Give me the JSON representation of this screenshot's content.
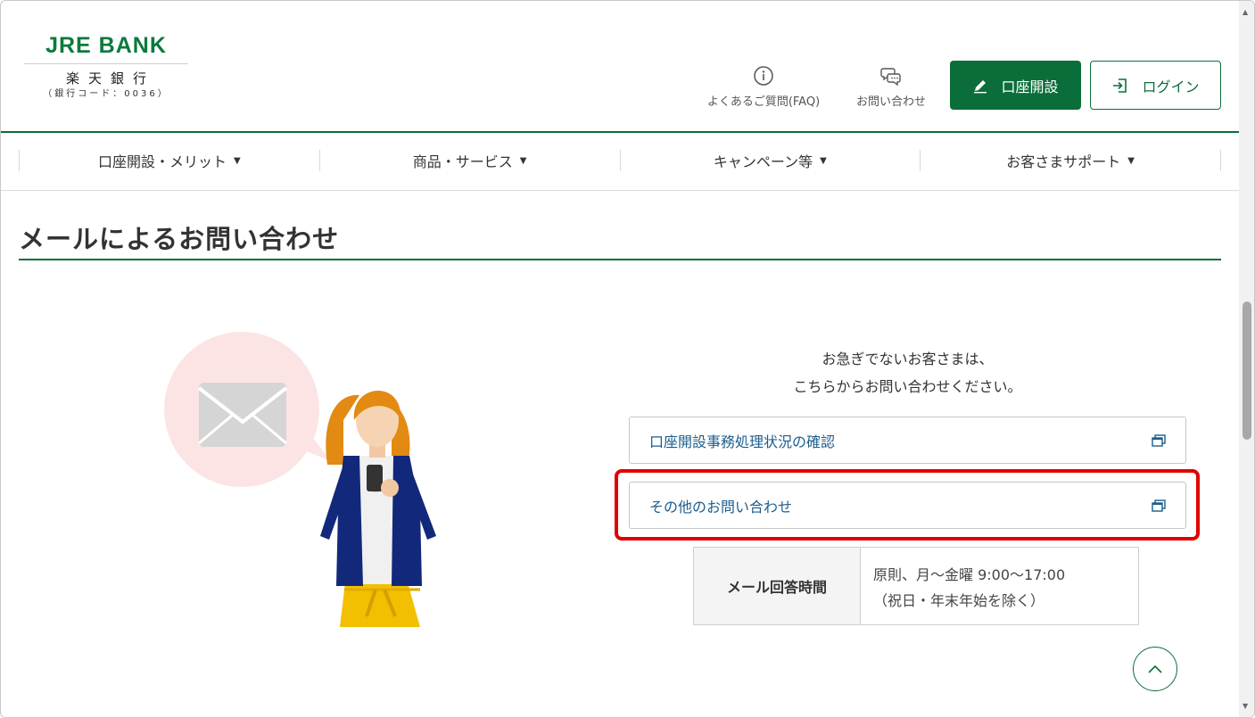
{
  "logo": {
    "brand": "JRE BANK",
    "jpname": "楽天銀行",
    "code": "（銀行コード：0036）"
  },
  "header": {
    "faq_label": "よくあるご質問(FAQ)",
    "contact_label": "お問い合わせ",
    "open_account_label": "口座開設",
    "login_label": "ログイン"
  },
  "nav": {
    "items": [
      {
        "label": "口座開設・メリット"
      },
      {
        "label": "商品・サービス"
      },
      {
        "label": "キャンペーン等"
      },
      {
        "label": "お客さまサポート"
      }
    ]
  },
  "main": {
    "title": "メールによるお問い合わせ",
    "intro_line1": "お急ぎでないお客さまは、",
    "intro_line2": "こちらからお問い合わせください。",
    "links": [
      {
        "label": "口座開設事務処理状況の確認"
      },
      {
        "label": "その他のお問い合わせ"
      }
    ],
    "hours": {
      "header": "メール回答時間",
      "line1": "原則、月〜金曜 9:00〜17:00",
      "line2": "（祝日・年末年始を除く）"
    }
  },
  "colors": {
    "brand_green": "#0b6e3a",
    "link_blue": "#1c5d8c",
    "highlight_red": "#e00000"
  },
  "icons": {
    "faq": "info-circle-icon",
    "contact": "chat-bubbles-icon",
    "open_account": "pencil-icon",
    "login": "login-arrow-icon",
    "external": "external-window-icon",
    "to_top": "chevron-up-icon"
  }
}
